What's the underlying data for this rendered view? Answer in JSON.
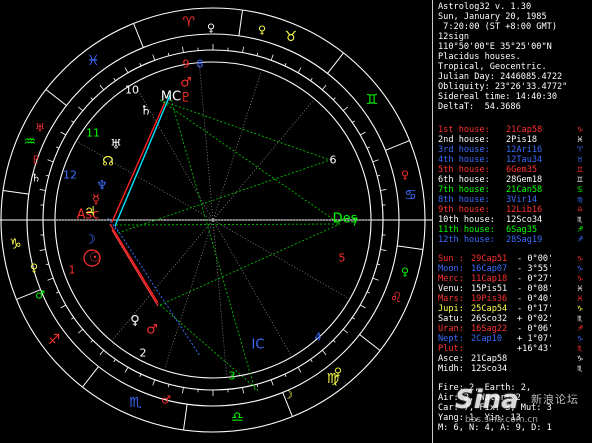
{
  "app": {
    "title": "Astrolog32 v. 1.30",
    "info_lines": [
      "Sun, January 20, 1985",
      " 7:20:00 (ST +8:00 GMT)",
      "12sign",
      "110°50'00\"E 35°25'00\"N",
      "Placidus houses.",
      "Tropical, Geocentric.",
      "Julian Day: 2446085.4722",
      "Obliquity: 23°26'33.4772\"",
      "Sidereal time: 14:40:30",
      "DeltaT:  54.3686"
    ]
  },
  "colors": {
    "background": "#000000",
    "ring": "#ffffff",
    "fire": "#ff3030",
    "earth": "#ffff50",
    "air": "#00ff00",
    "water": "#3b6cff",
    "cyan": "#00e5ff",
    "green_aspect": "#00c000",
    "red_aspect": "#ff2020",
    "blue_aspect": "#3b6cff"
  },
  "houses": [
    {
      "label": "1st house:",
      "value": "21Cap58",
      "color": "#ff3030",
      "glyph": "♑"
    },
    {
      "label": "2nd house:",
      "value": "2Pis18",
      "color": "#ffffff",
      "glyph": "♓"
    },
    {
      "label": "3rd house:",
      "value": "12Ari16",
      "color": "#3b6cff",
      "glyph": "♈"
    },
    {
      "label": "4th house:",
      "value": "12Tau34",
      "color": "#3b6cff",
      "glyph": "♉"
    },
    {
      "label": "5th house:",
      "value": "6Gem35",
      "color": "#ff3030",
      "glyph": "♊"
    },
    {
      "label": "6th house:",
      "value": "28Gem18",
      "color": "#ffffff",
      "glyph": "♊"
    },
    {
      "label": "7th house:",
      "value": "21Can58",
      "color": "#00ff00",
      "glyph": "♋"
    },
    {
      "label": "8th house:",
      "value": "3Vir14",
      "color": "#3b6cff",
      "glyph": "♍"
    },
    {
      "label": "9th house:",
      "value": "12Lib16",
      "color": "#ff3030",
      "glyph": "♎"
    },
    {
      "label": "10th house:",
      "value": "12Sco34",
      "color": "#ffffff",
      "glyph": "♏"
    },
    {
      "label": "11th house:",
      "value": "6Sag35",
      "color": "#00ff00",
      "glyph": "♐"
    },
    {
      "label": "12th house:",
      "value": "28Sag19",
      "color": "#3b6cff",
      "glyph": "♐"
    }
  ],
  "planets": [
    {
      "name": "Sun :",
      "pos": "29Cap51",
      "speed": "- 0°00'",
      "color": "#ff3030",
      "glyph": "♑"
    },
    {
      "name": "Moon:",
      "pos": "16Cap07",
      "speed": "- 3°55'",
      "color": "#3b6cff",
      "glyph": "♑"
    },
    {
      "name": "Merc:",
      "pos": "11Cap18",
      "speed": "- 0°27'",
      "color": "#ff3030",
      "glyph": "♑"
    },
    {
      "name": "Venu:",
      "pos": "15Pis51",
      "speed": "- 0°08'",
      "color": "#ffffff",
      "glyph": "♓"
    },
    {
      "name": "Mars:",
      "pos": "19Pis36",
      "speed": "- 0°40'",
      "color": "#ff3030",
      "glyph": "♓"
    },
    {
      "name": "Jupi:",
      "pos": "25Cap54",
      "speed": "- 0°17'",
      "color": "#ffff50",
      "glyph": "♑"
    },
    {
      "name": "Satu:",
      "pos": "26Sco32",
      "speed": "+ 0°02'",
      "color": "#ffffff",
      "glyph": "♏"
    },
    {
      "name": "Uran:",
      "pos": "16Sag22",
      "speed": "- 0°06'",
      "color": "#ff3030",
      "glyph": "♐"
    },
    {
      "name": "Nept:",
      "pos": "2Cap10",
      "speed": "+ 1°07'",
      "color": "#3b6cff",
      "glyph": "♑"
    },
    {
      "name": "Plut:",
      "pos": "",
      "speed": "+16°43'",
      "color": "#ff3030",
      "glyph": "♏"
    },
    {
      "name": "Asce:",
      "pos": "21Cap58",
      "speed": "",
      "color": "#ffffff",
      "glyph": "♑"
    },
    {
      "name": "Midh:",
      "pos": "12Sco34",
      "speed": "",
      "color": "#ffffff",
      "glyph": "♏"
    }
  ],
  "footer_lines": [
    "Fire: 2, Earth: 2,",
    "Air: 2, Water: 2",
    "Car: 7, Fix: 3, Mut: 3",
    "Yang: 1, Yin: 13",
    "M: 6, N: 4, A: 9, D: 1"
  ],
  "wheel": {
    "signs": [
      {
        "glyph": "♑",
        "color": "#ffff50"
      },
      {
        "glyph": "♐",
        "color": "#ff3030"
      },
      {
        "glyph": "♏",
        "color": "#3b6cff"
      },
      {
        "glyph": "♎",
        "color": "#00ff00"
      },
      {
        "glyph": "♍",
        "color": "#ffff50"
      },
      {
        "glyph": "♌",
        "color": "#ff3030"
      },
      {
        "glyph": "♋",
        "color": "#3b6cff"
      },
      {
        "glyph": "♊",
        "color": "#00ff00"
      },
      {
        "glyph": "♉",
        "color": "#ffff50"
      },
      {
        "glyph": "♈",
        "color": "#ff3030"
      },
      {
        "glyph": "♓",
        "color": "#3b6cff"
      },
      {
        "glyph": "♒",
        "color": "#00ff00"
      }
    ],
    "house_numbers": [
      {
        "n": "1",
        "color": "#ff3030"
      },
      {
        "n": "2",
        "color": "#ffffff"
      },
      {
        "n": "3",
        "color": "#00ff00"
      },
      {
        "n": "4",
        "color": "#3b6cff"
      },
      {
        "n": "5",
        "color": "#ff3030"
      },
      {
        "n": "6",
        "color": "#ffffff"
      },
      {
        "n": "7",
        "color": "#00ff00"
      },
      {
        "n": "8",
        "color": "#3b6cff"
      },
      {
        "n": "9",
        "color": "#ff3030"
      },
      {
        "n": "10",
        "color": "#ffffff"
      },
      {
        "n": "11",
        "color": "#00ff00"
      },
      {
        "n": "12",
        "color": "#3b6cff"
      }
    ],
    "axis_labels": {
      "asc": "Asc",
      "des": "Des",
      "mc": "MC",
      "ic": "IC"
    }
  },
  "watermark": {
    "brand": "Sina",
    "sub": "新浪论坛",
    "url": "bbs.sina.com.cn"
  }
}
